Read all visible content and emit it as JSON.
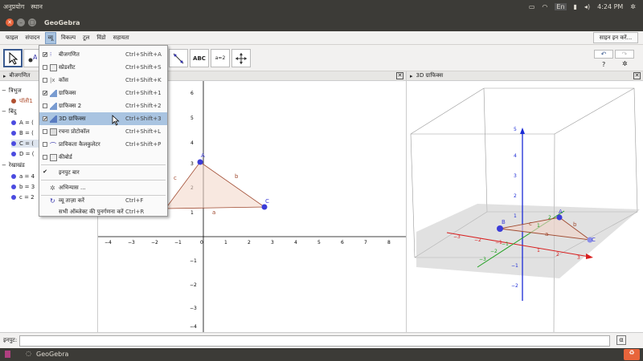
{
  "system_bar": {
    "menus": [
      "अनुप्रयोग",
      "स्थान"
    ],
    "keyboard": "En",
    "time": "4:24 PM"
  },
  "window": {
    "title": "GeoGebra"
  },
  "menubar": {
    "items": [
      "फाइल",
      "संपादन",
      "व्यू",
      "विकल्प",
      "टूल",
      "विंडो",
      "सहायता"
    ],
    "signin": "साइन इन करें..."
  },
  "toolbar": {
    "text_tool": "ABC",
    "slider_tool": "a=2"
  },
  "algebra": {
    "header": "बीजगणित",
    "groups": [
      {
        "label": "त्रिभुज",
        "items": [
          "पॉली1"
        ]
      },
      {
        "label": "बिंदु",
        "items": [
          "A = (",
          "B = (",
          "C = (",
          "D = ("
        ]
      },
      {
        "label": "रेखाखंड",
        "items": [
          "a = 4",
          "b = 3",
          "c = 2"
        ]
      }
    ]
  },
  "graphics": {
    "y_ticks": [
      "6",
      "5",
      "4",
      "3",
      "2",
      "1",
      "−1",
      "−2",
      "−3",
      "−4"
    ],
    "x_ticks": [
      "−4",
      "−3",
      "−2",
      "−1",
      "0",
      "1",
      "2",
      "3",
      "4",
      "5",
      "6",
      "7",
      "8"
    ],
    "points": [
      "A",
      "C"
    ],
    "segments": [
      "a",
      "b",
      "c"
    ]
  },
  "view3d": {
    "header": "3D ग्राफिक्स",
    "z_ticks": [
      "5",
      "4",
      "3",
      "2",
      "1",
      "−1",
      "−2"
    ],
    "x_ticks": [
      "−3",
      "−2",
      "−1",
      "1",
      "2",
      "3"
    ],
    "y_ticks": [
      "−3",
      "−2",
      "−1",
      "1",
      "2"
    ],
    "points": [
      "A",
      "B",
      "C"
    ],
    "segments": [
      "a",
      "b",
      "c"
    ]
  },
  "view_menu": {
    "items": [
      {
        "label": "बीजगणित",
        "shortcut": "Ctrl+Shift+A",
        "checked": true
      },
      {
        "label": "स्प्रेडशीट",
        "shortcut": "Ctrl+Shift+S",
        "checked": false
      },
      {
        "label": "कॉस",
        "shortcut": "Ctrl+Shift+K",
        "checked": false
      },
      {
        "label": "ग्राफिक्स",
        "shortcut": "Ctrl+Shift+1",
        "checked": true
      },
      {
        "label": "ग्राफिक्स 2",
        "shortcut": "Ctrl+Shift+2",
        "checked": false
      },
      {
        "label": "3D ग्राफिक्स",
        "shortcut": "Ctrl+Shift+3",
        "checked": true
      },
      {
        "label": "रचना प्रोटोकॉल",
        "shortcut": "Ctrl+Shift+L",
        "checked": false
      },
      {
        "label": "प्रायिकता कैलकुलेटर",
        "shortcut": "Ctrl+Shift+P",
        "checked": false
      },
      {
        "label": "कीबोर्ड",
        "shortcut": "",
        "checked": false
      },
      {
        "label": "इनपुट बार",
        "shortcut": "",
        "checked": true
      },
      {
        "label": "अभिन्यास ...",
        "shortcut": "",
        "checked": false
      },
      {
        "label": "व्यू ताज़ा करें",
        "shortcut": "Ctrl+F",
        "checked": false
      },
      {
        "label": "सभी ऑब्जेक्ट की पुनर्गणना करें",
        "shortcut": "Ctrl+R",
        "checked": false
      }
    ]
  },
  "inputbar": {
    "label": "इनपुट:"
  },
  "taskbar": {
    "app": "GeoGebra"
  }
}
